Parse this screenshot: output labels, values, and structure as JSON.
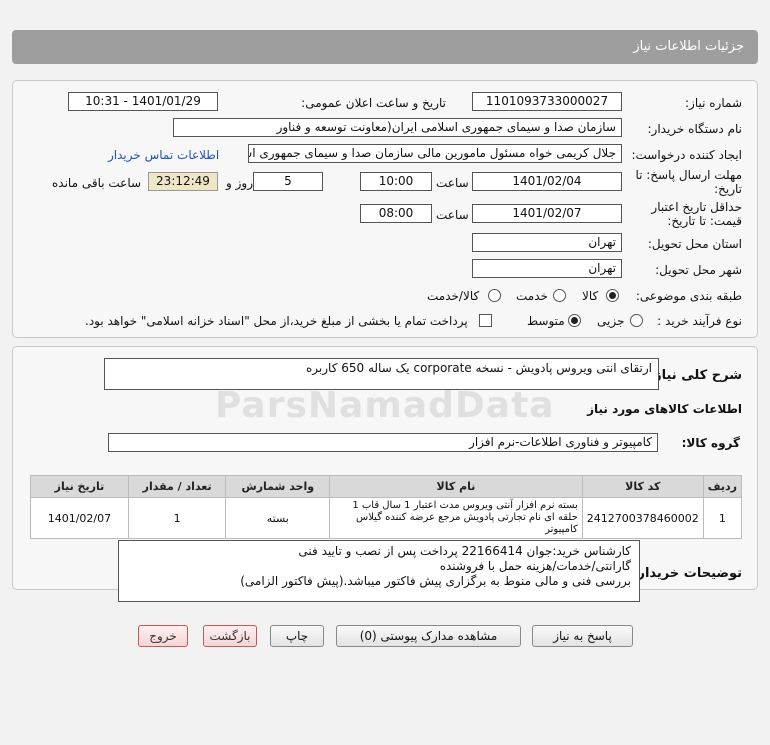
{
  "header": {
    "title": "جزئیات اطلاعات نیاز"
  },
  "fields": {
    "need_number_label": "شماره نیاز:",
    "need_number": "1101093733000027",
    "announce_label": "تاریخ و ساعت اعلان عمومی:",
    "announce_value": "1401/01/29 - 10:31",
    "buyer_org_label": "نام دستگاه خریدار:",
    "buyer_org": "سازمان صدا و سیمای جمهوری اسلامی ایران(معاونت توسعه و فناور",
    "creator_label": "ایجاد کننده درخواست:",
    "creator": "جلال کریمی خواه مسئول مامورین مالی  سازمان صدا و سیمای جمهوری اسلا",
    "contact_link": "اطلاعات تماس خریدار",
    "reply_deadline_label": "مهلت ارسال پاسخ: تا تاریخ:",
    "reply_date": "1401/02/04",
    "time_label": "ساعت",
    "reply_time": "10:00",
    "days_value": "5",
    "days_label": "روز و",
    "remaining_time": "23:12:49",
    "remaining_label": "ساعت باقی مانده",
    "validity_label": "حداقل تاریخ اعتبار قیمت: تا تاریخ:",
    "validity_date": "1401/02/07",
    "validity_time": "08:00",
    "province_label": "استان محل تحویل:",
    "province": "تهران",
    "city_label": "شهر محل تحویل:",
    "city": "تهران",
    "category_label": "طبقه بندی موضوعی:",
    "category_options": [
      "کالا",
      "خدمت",
      "کالا/خدمت"
    ],
    "process_label": "نوع فرآیند خرید :",
    "process_options": [
      "جزیی",
      "متوسط"
    ],
    "process_note": "پرداخت تمام یا بخشی از مبلغ خرید،از محل \"اسناد خزانه اسلامی\" خواهد بود."
  },
  "summary": {
    "label": "شرح کلی نیاز:",
    "text": "ارتقای انتی ویروس پادویش - نسخه corporate یک ساله 650 کاربره"
  },
  "goods": {
    "section_title": "اطلاعات کالاهای مورد نیاز",
    "group_label": "گروه کالا:",
    "group_value": "کامپیوتر و فناوری اطلاعات-نرم افزار",
    "columns": [
      "ردیف",
      "کد کالا",
      "نام کالا",
      "واحد شمارش",
      "تعداد / مقدار",
      "تاریخ نیاز"
    ],
    "rows": [
      {
        "index": "1",
        "code": "2412700378460002",
        "name": "بسته نرم افزار آنتی ویروس مدت اعتبار 1 سال قاب 1 حلقه ای نام تجارتی پادویش مرجع عرضه کننده گیلاس کامپیوتر",
        "unit": "بسته",
        "qty": "1",
        "date": "1401/02/07"
      }
    ]
  },
  "buyer_notes": {
    "label": "توضیحات خریدار:",
    "lines": [
      "کارشناس خرید:جوان 22166414    پرداخت پس از نصب و تایید فنی",
      "گارانتی/خدمات/هزینه حمل با فروشنده",
      "بررسی فنی و مالی منوط به برگزاری پیش فاکتور میباشد.(پیش فاکتور الزامی)"
    ]
  },
  "buttons": {
    "reply": "پاسخ به نیاز",
    "attachments": "مشاهده مدارک پیوستی (0)",
    "print": "چاپ",
    "back": "بازگشت",
    "exit": "خروج"
  },
  "watermark": "ParsNamadData"
}
